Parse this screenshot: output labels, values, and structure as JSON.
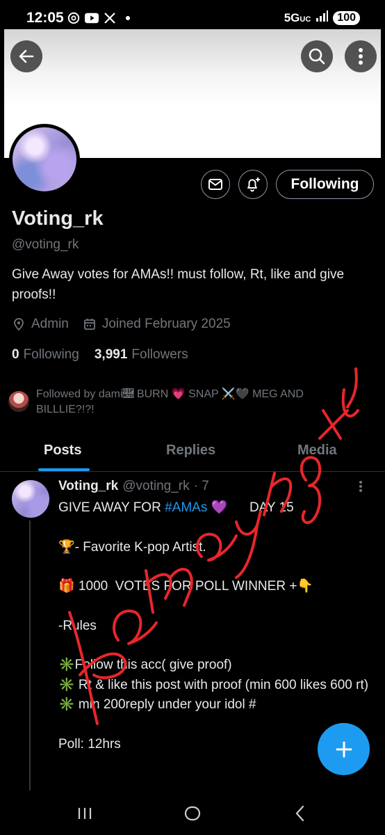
{
  "status_bar": {
    "time": "12:05",
    "app_icons": [
      "threads-icon",
      "youtube-icon",
      "x-icon"
    ],
    "network": "5G",
    "network_suffix": "UC",
    "battery": "100"
  },
  "profile": {
    "name": "Voting_rk",
    "handle": "@voting_rk",
    "bio": "Give Away votes for AMAs!! must follow, Rt, like and give proofs!!",
    "role": "Admin",
    "joined": "Joined February 2025",
    "following_count": "0",
    "following_label": "Following",
    "followers_count": "3,991",
    "followers_label": "Followers",
    "followed_by": "Followed by dami🩽 BURN 💗 SNAP ⚔️🖤 MEG AND BILLLIE?!?!"
  },
  "actions": {
    "following_button": "Following"
  },
  "tabs": [
    {
      "label": "Posts",
      "active": true
    },
    {
      "label": "Replies",
      "active": false
    },
    {
      "label": "Media",
      "active": false
    }
  ],
  "post": {
    "author_name": "Voting_rk",
    "author_handle": "@voting_rk",
    "time": "· 7",
    "line1_prefix": "GIVE AWAY FOR ",
    "line1_hashtag": "#AMAs",
    "line1_suffix": " 💜      DAY 15",
    "lines": [
      "",
      "🏆- Favorite K-pop Artist.",
      "",
      "🎁 1000  VOTES FOR POLL WINNER +👇",
      "",
      "-Rules",
      "",
      "✳️Follow this acc( give proof)",
      "✳️ Rt & like this post with proof (min 600 likes 600 rt)",
      "✳️ min 200reply under your idol #",
      "",
      "Poll: 12hrs"
    ]
  },
  "watermark_text": "kamyangxu",
  "colors": {
    "accent": "#1d9bf0",
    "background": "#000000",
    "text_primary": "#e7e9ea",
    "text_secondary": "#71767b",
    "watermark": "#e8262b"
  }
}
